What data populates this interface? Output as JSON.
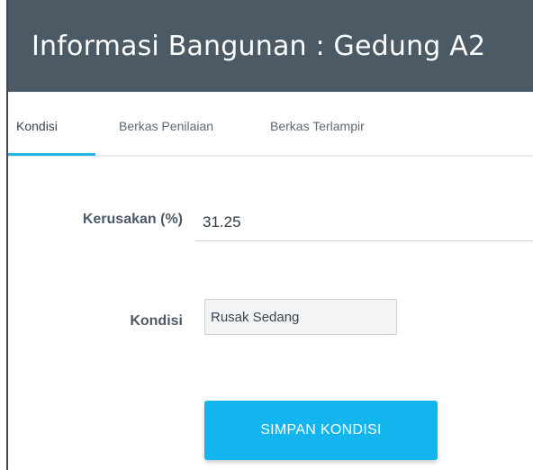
{
  "header": {
    "title": "Informasi Bangunan : Gedung A2"
  },
  "tabs": [
    {
      "label": "Kondisi",
      "active": true
    },
    {
      "label": "Berkas Penilaian",
      "active": false
    },
    {
      "label": "Berkas Terlampir",
      "active": false
    }
  ],
  "form": {
    "damage_label": "Kerusakan (%)",
    "damage_value": "31.25",
    "condition_label": "Kondisi",
    "condition_value": "Rusak Sedang",
    "save_label": "SIMPAN KONDISI"
  },
  "colors": {
    "header_bg": "#4b5a64",
    "accent": "#23b5ea",
    "button_bg": "#12b5ee"
  }
}
